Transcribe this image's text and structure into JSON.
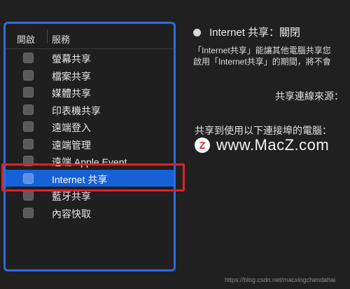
{
  "services": {
    "header_enable": "開啟",
    "header_service": "服務",
    "items": [
      {
        "label": "螢幕共享",
        "selected": false
      },
      {
        "label": "檔案共享",
        "selected": false
      },
      {
        "label": "媒體共享",
        "selected": false
      },
      {
        "label": "印表機共享",
        "selected": false
      },
      {
        "label": "遠端登入",
        "selected": false
      },
      {
        "label": "遠端管理",
        "selected": false
      },
      {
        "label": "遠端 Apple Event",
        "selected": false
      },
      {
        "label": "Internet 共享",
        "selected": true
      },
      {
        "label": "藍牙共享",
        "selected": false
      },
      {
        "label": "內容快取",
        "selected": false
      }
    ]
  },
  "detail": {
    "status": "Internet 共享：關閉",
    "desc_line1": "「Internet共享」能讓其他電腦共享您",
    "desc_line2": "啟用「Internet共享」的期間，將不會",
    "share_from_label": "共享連線來源：",
    "share_to_label": "共享到使用以下連接埠的電腦："
  },
  "watermark": {
    "logo": "Z",
    "text": "www.MacZ.com"
  },
  "caption": "https://blog.csdn.net/macxingchendahai",
  "colors": {
    "accent_blue": "#1660d8",
    "panel_border": "#2b6fd6",
    "highlight_red": "#e0202a"
  }
}
